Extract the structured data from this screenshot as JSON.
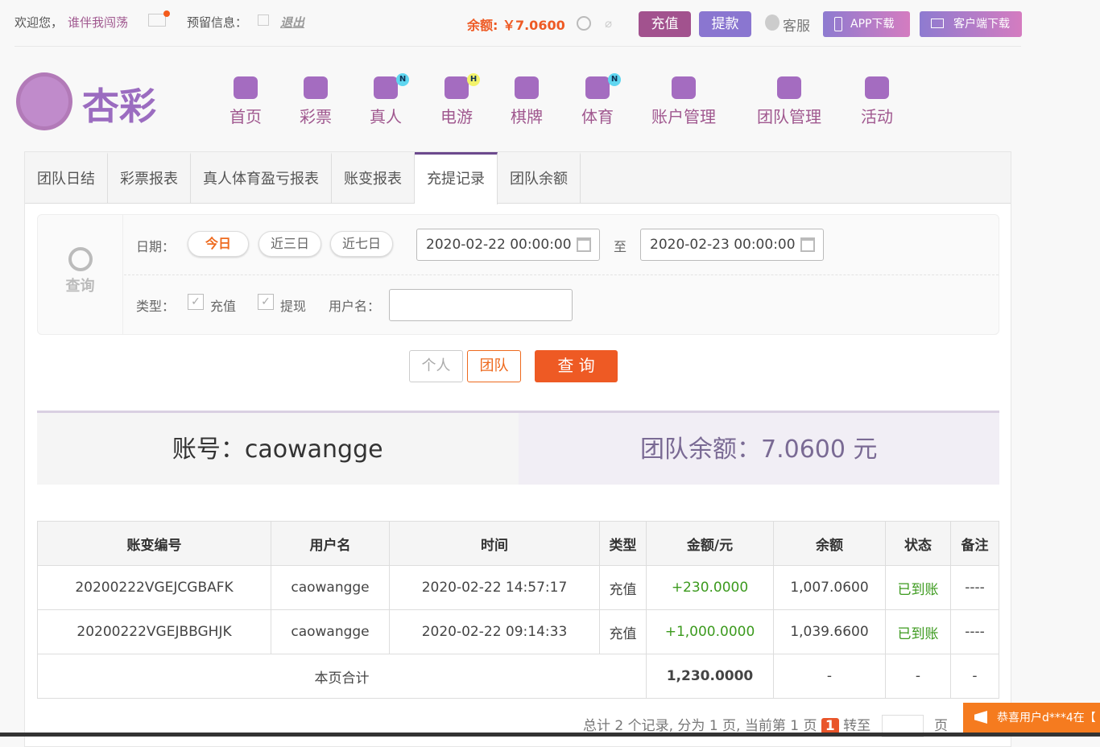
{
  "topbar": {
    "welcome": "欢迎您，",
    "username": "谁伴我闯荡",
    "reserved_label": "预留信息：",
    "logout": "退出",
    "balance": "余额: ￥7.0600",
    "recharge": "充值",
    "withdraw": "提款",
    "service": "客服",
    "app_download": "APP下载",
    "client_download": "客户端下载"
  },
  "logo": {
    "text": "杏彩"
  },
  "nav": [
    {
      "label": "首页",
      "icon": "home-icon"
    },
    {
      "label": "彩票",
      "icon": "ticket-icon"
    },
    {
      "label": "真人",
      "icon": "dealer-icon",
      "badge": "N"
    },
    {
      "label": "电游",
      "icon": "gamepad-icon",
      "badge": "H"
    },
    {
      "label": "棋牌",
      "icon": "cards-icon"
    },
    {
      "label": "体育",
      "icon": "trophy-icon",
      "badge": "N"
    },
    {
      "label": "账户管理",
      "icon": "yuan-coin-icon"
    },
    {
      "label": "团队管理",
      "icon": "team-icon"
    },
    {
      "label": "活动",
      "icon": "gift-icon"
    }
  ],
  "tabs": [
    {
      "label": "团队日结"
    },
    {
      "label": "彩票报表"
    },
    {
      "label": "真人体育盈亏报表"
    },
    {
      "label": "账变报表"
    },
    {
      "label": "充提记录",
      "active": true
    },
    {
      "label": "团队余额"
    }
  ],
  "query": {
    "icon_label": "查询",
    "date_label": "日期：",
    "today": "今日",
    "three_days": "近三日",
    "seven_days": "近七日",
    "start": "2020-02-22 00:00:00",
    "to": "至",
    "end": "2020-02-23 00:00:00",
    "type_label": "类型：",
    "recharge": "充值",
    "withdraw": "提现",
    "user_label": "用户名：",
    "user_value": "",
    "personal": "个人",
    "team": "团队",
    "submit": "查 询"
  },
  "summary": {
    "account": "账号：caowangge",
    "team_balance": "团队余额：7.0600 元"
  },
  "table": {
    "headers": [
      "账变编号",
      "用户名",
      "时间",
      "类型",
      "金额/元",
      "余额",
      "状态",
      "备注"
    ],
    "rows": [
      [
        "20200222VGEJCGBAFK",
        "caowangge",
        "2020-02-22 14:57:17",
        "充值",
        "+230.0000",
        "1,007.0600",
        "已到账",
        "----"
      ],
      [
        "20200222VGEJBBGHJK",
        "caowangge",
        "2020-02-22 09:14:33",
        "充值",
        "+1,000.0000",
        "1,039.6600",
        "已到账",
        "----"
      ]
    ],
    "total_label": "本页合计",
    "total_amount": "1,230.0000",
    "total_rest": [
      "-",
      "-",
      "-"
    ]
  },
  "pager": {
    "summary": "总计 2 个记录, 分为 1 页, 当前第 1 页",
    "current": "1",
    "goto": "转至",
    "page": "页"
  },
  "toast": {
    "text": "恭喜用户d***4在【"
  },
  "colors": {
    "accent": "#a0588f",
    "orange": "#ee5a24",
    "green": "#3c9a1e"
  }
}
